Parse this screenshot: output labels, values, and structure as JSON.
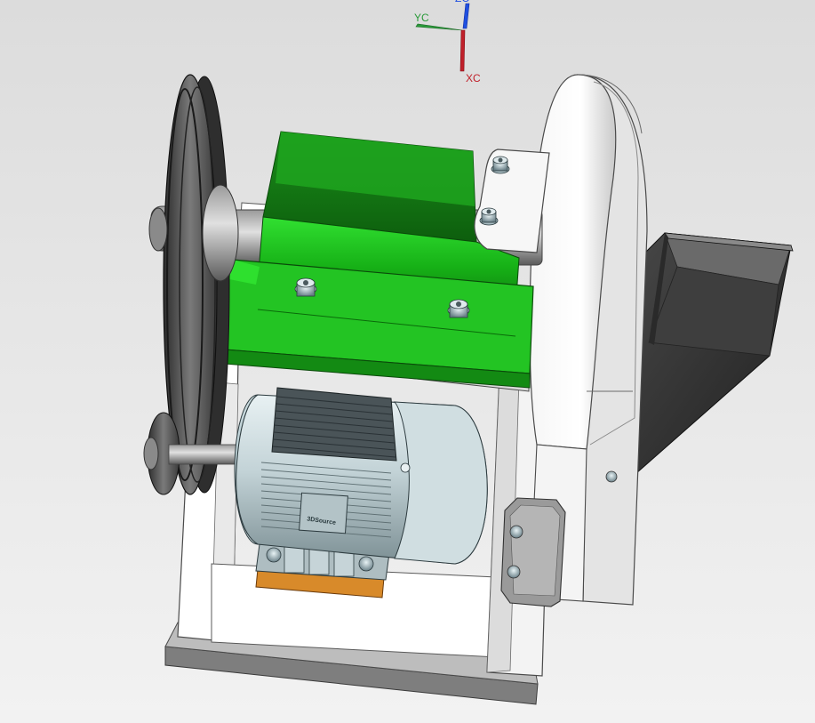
{
  "axes": {
    "x_label": "XC",
    "y_label": "YC",
    "z_label": "ZC",
    "x_color": "#c0202a",
    "y_color": "#2a9a3a",
    "z_color": "#1f4fe0"
  },
  "motor": {
    "brand_label": "3DSource"
  },
  "colors": {
    "bearing_housing": "#22c722",
    "frame": "#ffffff",
    "hopper": "#3a3a3a",
    "pulley": "#4a4a4a",
    "motor_body": "#b8c8cc",
    "motor_pad": "#d88a2a"
  }
}
